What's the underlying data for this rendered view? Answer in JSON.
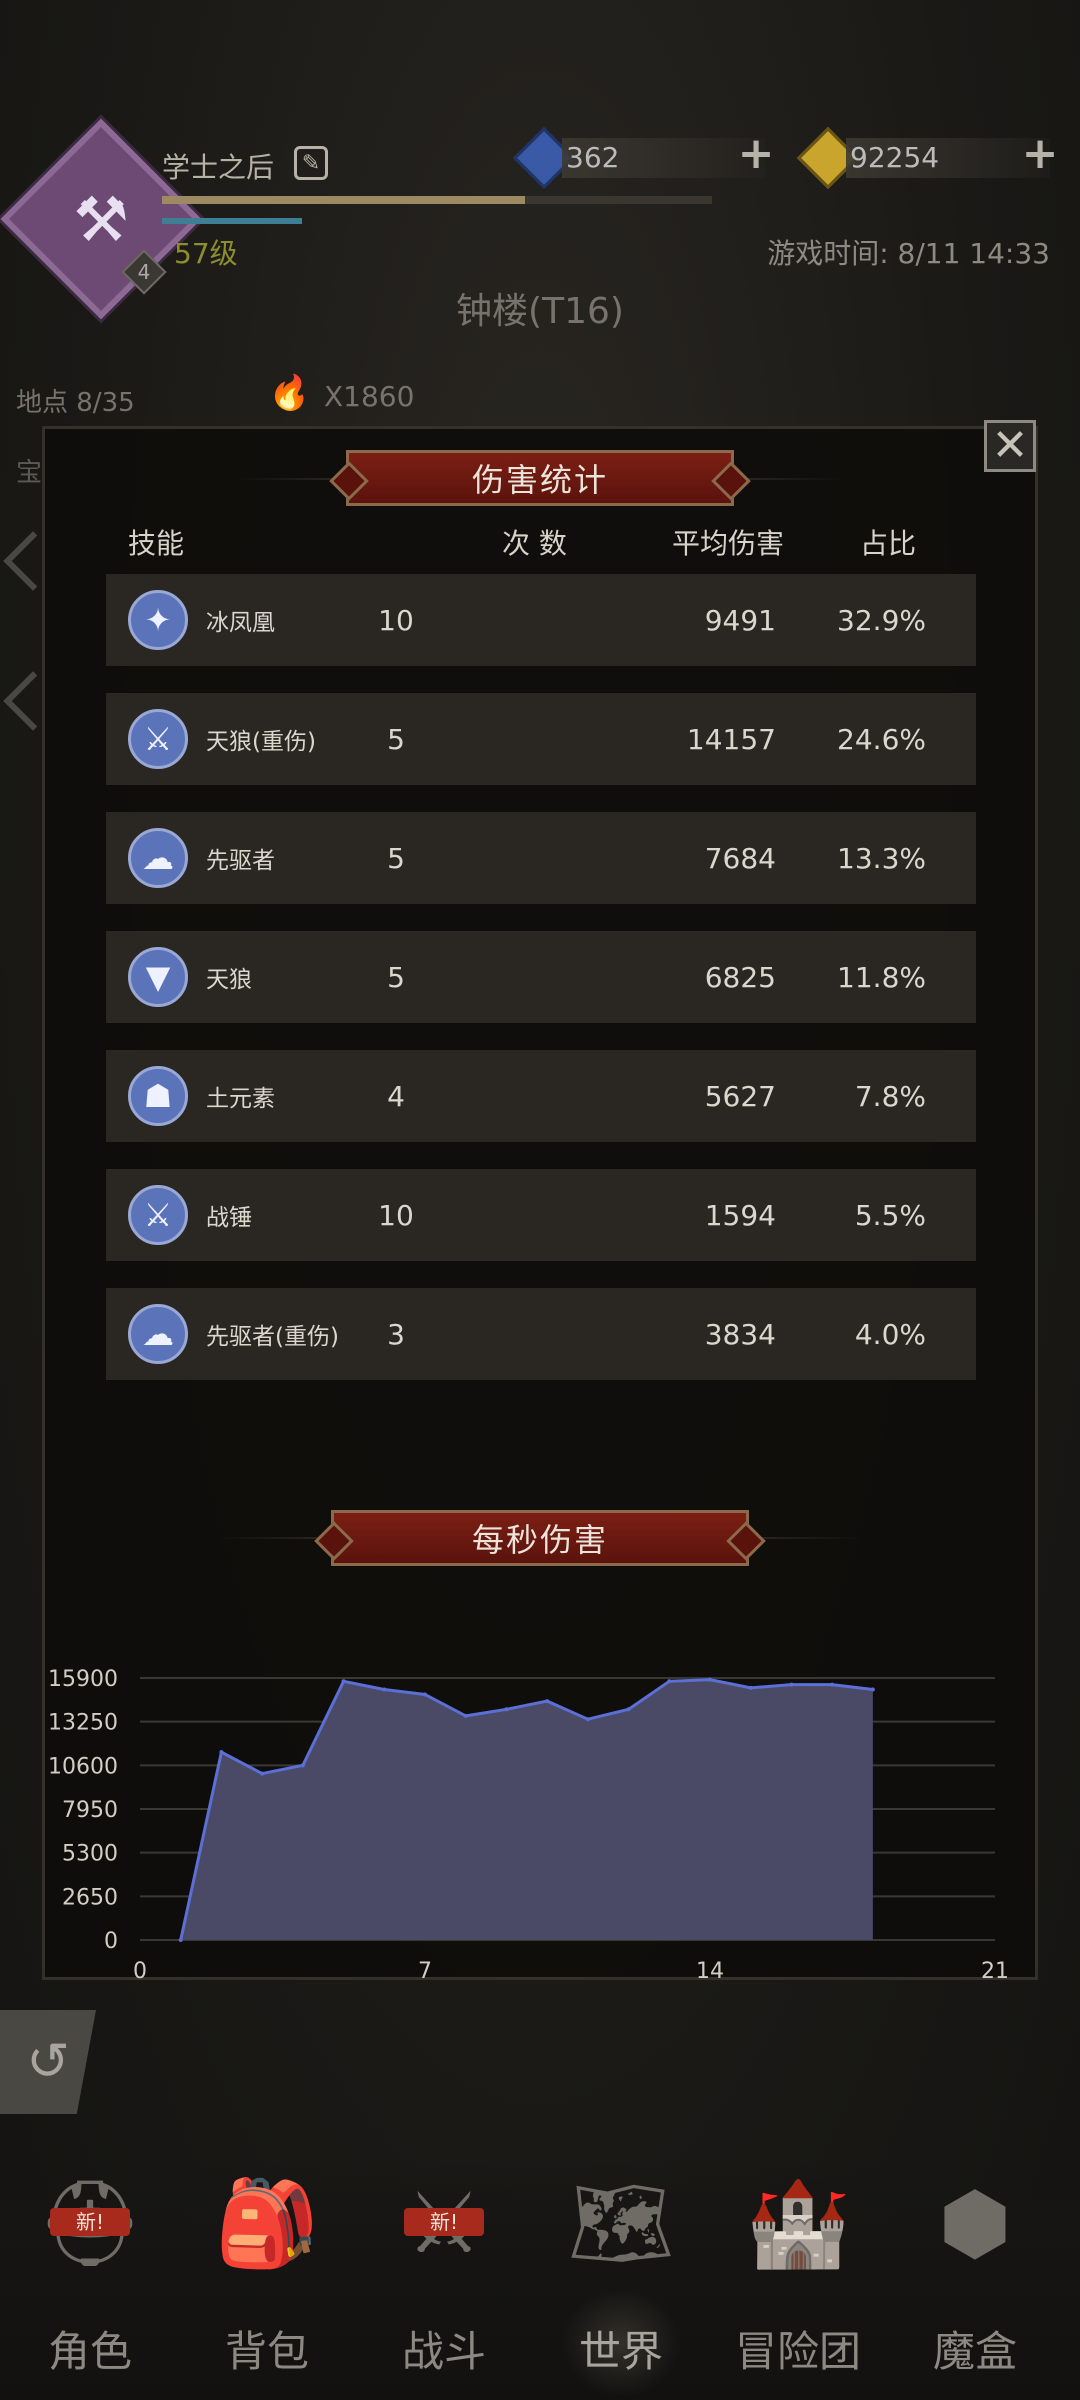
{
  "header": {
    "player_name": "学士之后",
    "level_badge": "4",
    "level_text": "57级",
    "exp_fraction": 0.66,
    "gems": "362",
    "gold": "92254",
    "game_time": "游戏时间: 8/11 14:33",
    "location_title": "钟楼(T16)",
    "waypoint": "地点 8/35",
    "torch_count": "X1860",
    "bg_text": "宝"
  },
  "dialog": {
    "damage_title": "伤害统计",
    "dps_title": "每秒伤害",
    "headers": {
      "skill": "技能",
      "count": "次 数",
      "avg": "平均伤害",
      "pct": "占比"
    },
    "rows": [
      {
        "icon": "bird-icon",
        "glyph": "✦",
        "skill": "冰凤凰",
        "count": "10",
        "avg": "9491",
        "pct": "32.9%"
      },
      {
        "icon": "sword-icon",
        "glyph": "⚔",
        "skill": "天狼(重伤)",
        "count": "5",
        "avg": "14157",
        "pct": "24.6%"
      },
      {
        "icon": "mushroom-cloud-icon",
        "glyph": "☁",
        "skill": "先驱者",
        "count": "5",
        "avg": "7684",
        "pct": "13.3%"
      },
      {
        "icon": "fangs-icon",
        "glyph": "▼",
        "skill": "天狼",
        "count": "5",
        "avg": "6825",
        "pct": "11.8%"
      },
      {
        "icon": "earth-elemental-icon",
        "glyph": "☗",
        "skill": "土元素",
        "count": "4",
        "avg": "5627",
        "pct": "7.8%"
      },
      {
        "icon": "sword-icon",
        "glyph": "⚔",
        "skill": "战锤",
        "count": "10",
        "avg": "1594",
        "pct": "5.5%"
      },
      {
        "icon": "mushroom-cloud-icon",
        "glyph": "☁",
        "skill": "先驱者(重伤)",
        "count": "3",
        "avg": "3834",
        "pct": "4.0%"
      }
    ]
  },
  "chart_data": {
    "type": "area",
    "x": [
      1,
      2,
      3,
      4,
      5,
      6,
      7,
      8,
      9,
      10,
      11,
      12,
      13,
      14,
      15,
      16,
      17,
      18
    ],
    "values": [
      0,
      11400,
      10100,
      10600,
      15700,
      15200,
      14900,
      13600,
      14000,
      14500,
      13400,
      14000,
      15700,
      15800,
      15300,
      15500,
      15500,
      15200
    ],
    "yticks": [
      "15900",
      "13250",
      "10600",
      "7950",
      "5300",
      "2650",
      "0"
    ],
    "xticks": [
      "0",
      "7",
      "14",
      "21"
    ],
    "ylim": [
      0,
      15900
    ],
    "xlim": [
      0,
      21
    ],
    "grid": true,
    "fill_color": "#4a4a66",
    "line_color": "#5b6fd6"
  },
  "nav": {
    "items": [
      {
        "label": "角色",
        "icon": "helmet-icon",
        "glyph": "⛑",
        "badge": "新!"
      },
      {
        "label": "背包",
        "icon": "backpack-icon",
        "glyph": "🎒",
        "badge": ""
      },
      {
        "label": "战斗",
        "icon": "shield-sword-icon",
        "glyph": "⚔",
        "badge": "新!"
      },
      {
        "label": "世界",
        "icon": "map-icon",
        "glyph": "🗺",
        "badge": ""
      },
      {
        "label": "冒险团",
        "icon": "castle-icon",
        "glyph": "🏰",
        "badge": ""
      },
      {
        "label": "魔盒",
        "icon": "cube-icon",
        "glyph": "⬢",
        "badge": ""
      }
    ],
    "active": "世界"
  },
  "colors": {
    "banner_red": "#7c1f14",
    "level_color": "#8f8e2f",
    "gem_blue": "#3a5aa8",
    "gold": "#c9a52e"
  }
}
